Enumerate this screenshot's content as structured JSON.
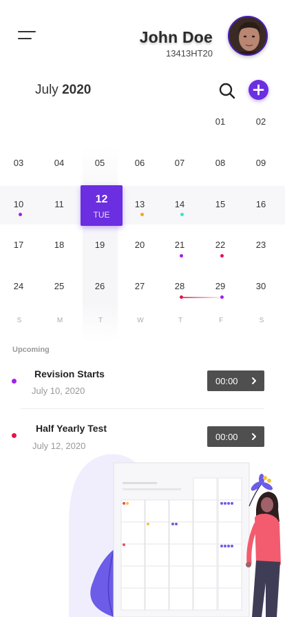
{
  "header": {
    "user_name": "John Doe",
    "user_id": "13413HT20",
    "menu_icon": "hamburger-menu-icon",
    "avatar_icon": "user-avatar"
  },
  "month": {
    "name": "July",
    "year": "2020",
    "search_icon": "search-icon",
    "add_icon": "plus-icon"
  },
  "calendar": {
    "week1": [
      "01",
      "02"
    ],
    "week2": [
      "03",
      "04",
      "05",
      "06",
      "07",
      "08",
      "09"
    ],
    "week3": [
      "10",
      "11",
      "12",
      "13",
      "14",
      "15",
      "16"
    ],
    "week4": [
      "17",
      "18",
      "19",
      "20",
      "21",
      "22",
      "23"
    ],
    "week5": [
      "24",
      "25",
      "26",
      "27",
      "28",
      "29",
      "30"
    ],
    "weekdays": [
      "S",
      "M",
      "T",
      "W",
      "T",
      "F",
      "S"
    ],
    "selected": {
      "day": "12",
      "weekday": "TUE"
    },
    "colors": {
      "accent": "#6b2ee0",
      "purple_dot": "#a21ff0",
      "orange_dot": "#f5a623",
      "teal_dot": "#3be0d8",
      "red_dot": "#e8104a"
    }
  },
  "upcoming": {
    "label": "Upcoming",
    "events": [
      {
        "title": "Revision Starts",
        "date": "July 10, 2020",
        "time": "00:00",
        "dot_color": "#a21ff0"
      },
      {
        "title": "Half Yearly Test",
        "date": "July 12, 2020",
        "time": "00:00",
        "dot_color": "#e8104a"
      }
    ]
  }
}
